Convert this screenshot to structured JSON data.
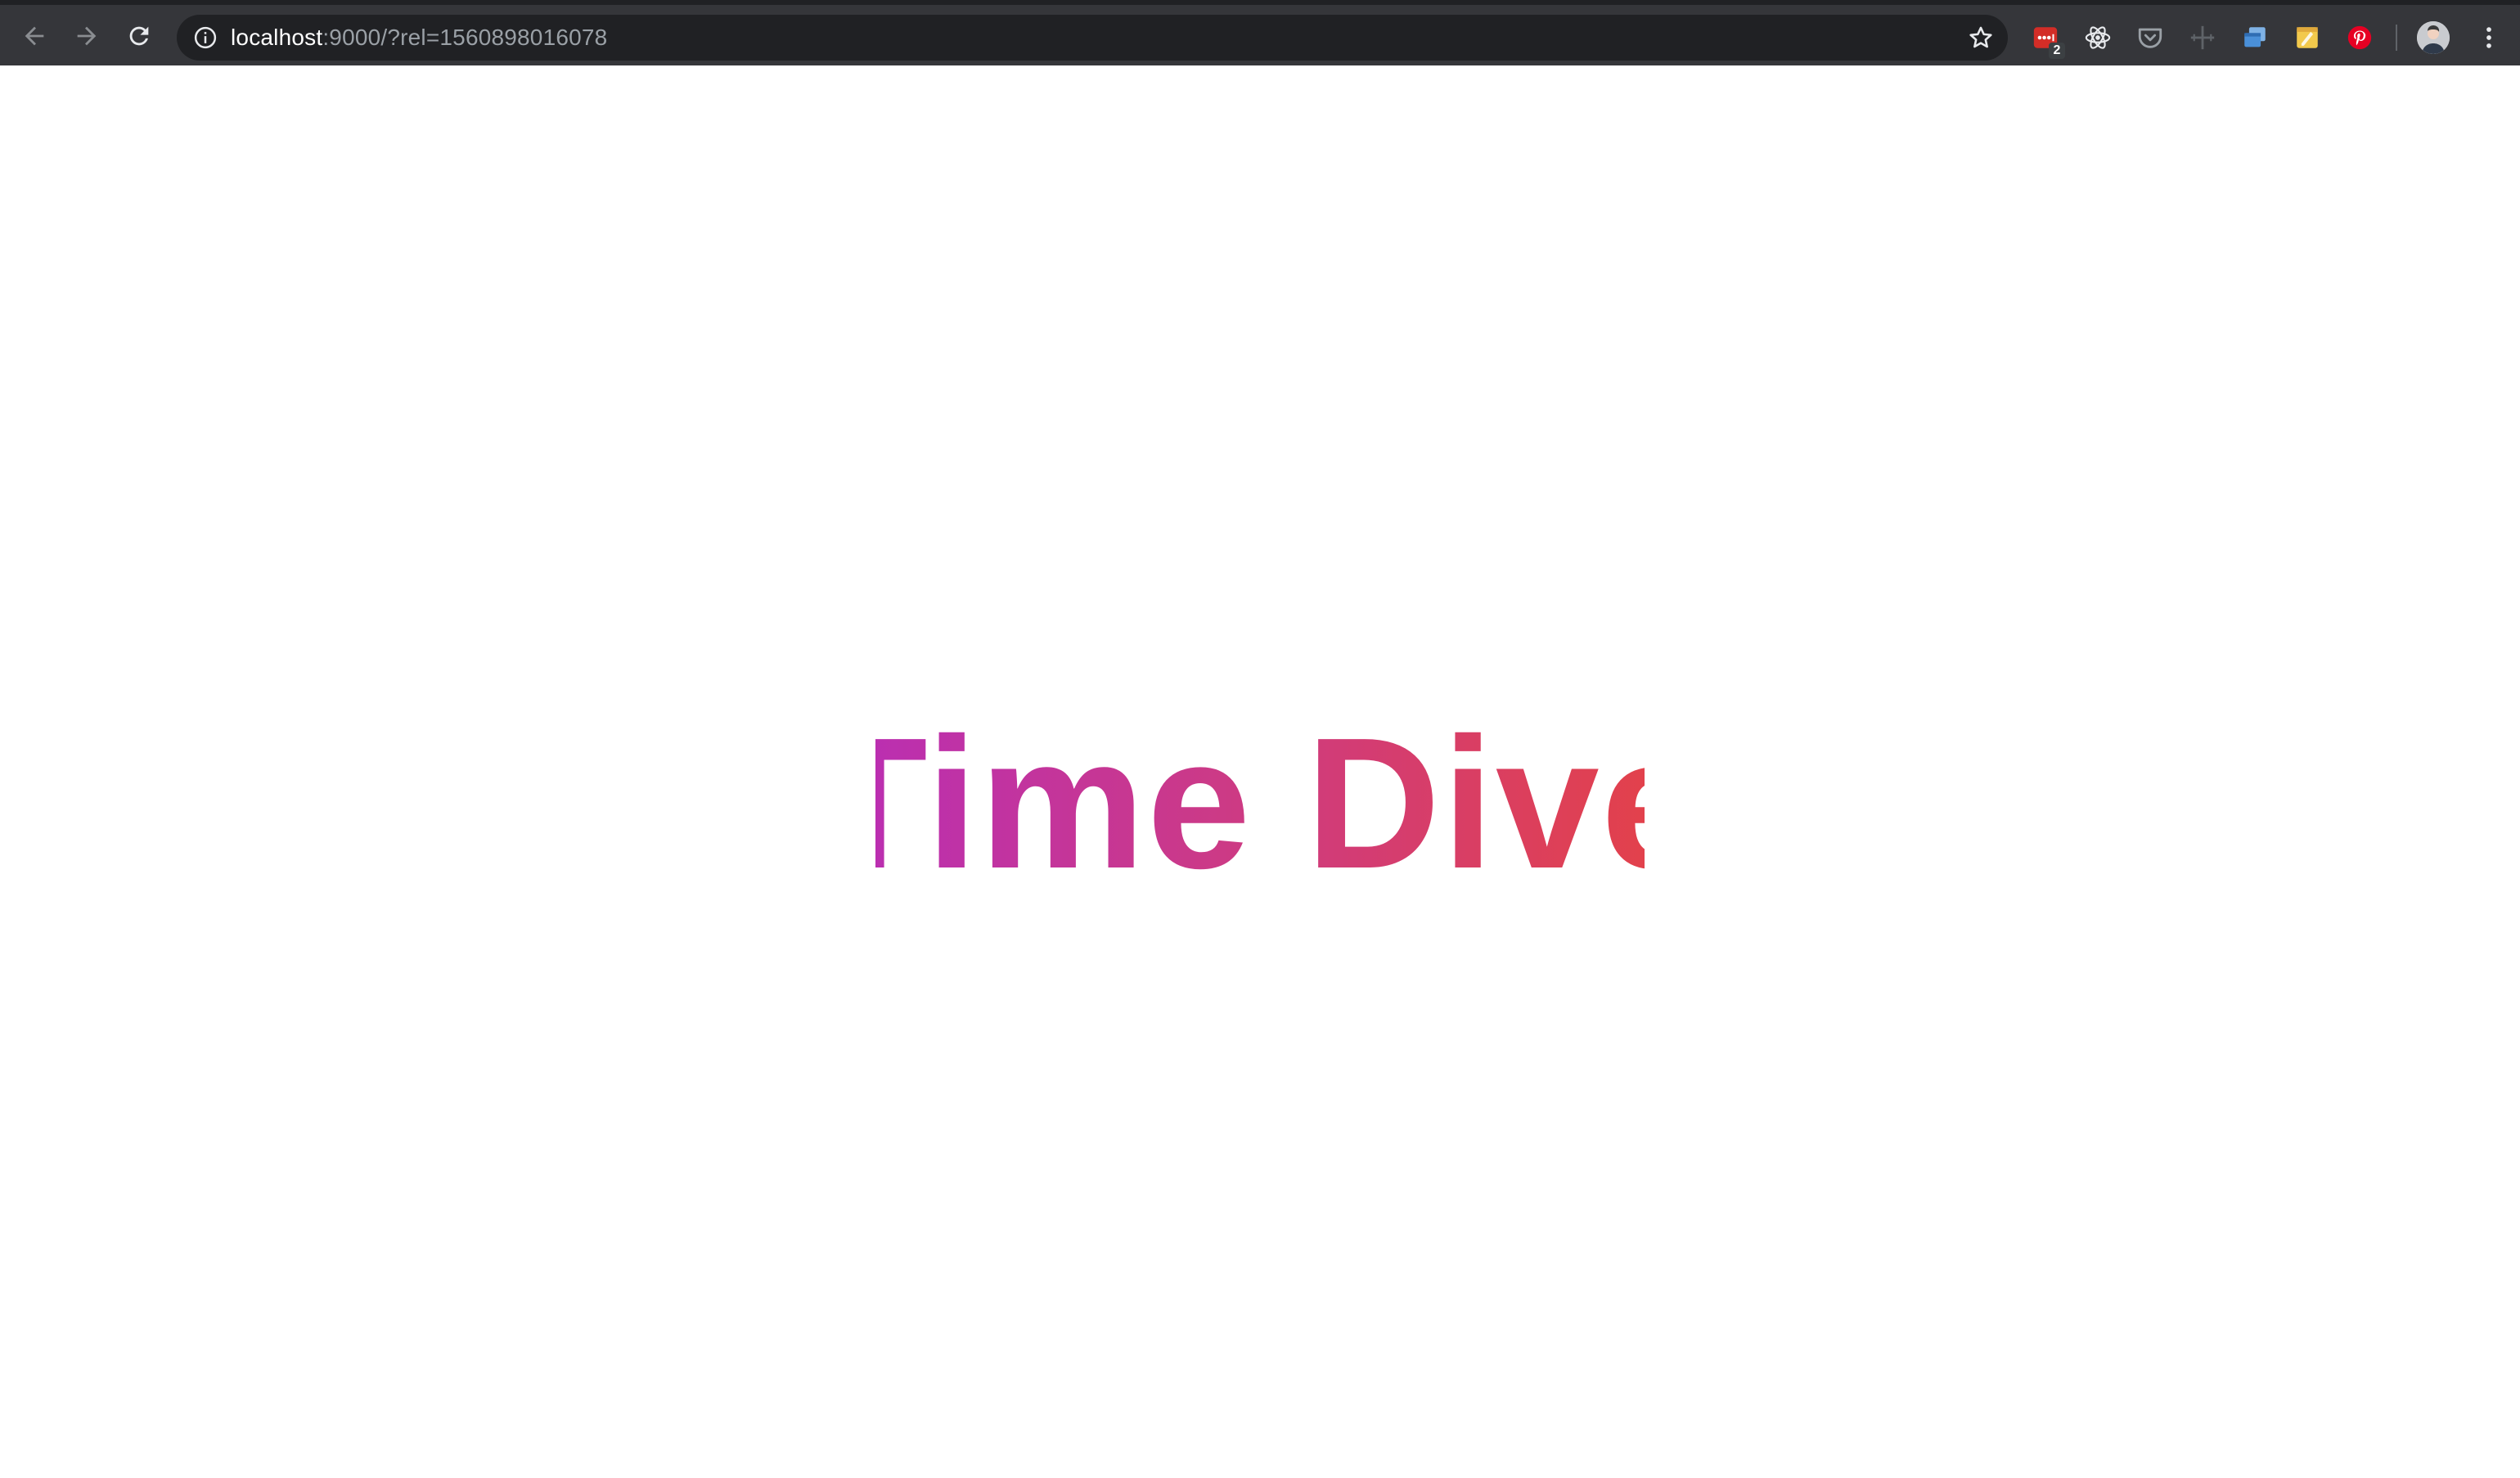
{
  "browser": {
    "url_host": "localhost",
    "url_rest": ":9000/?rel=1560898016078",
    "icons": {
      "back": "back-arrow-icon",
      "forward": "forward-arrow-icon",
      "reload": "reload-icon",
      "info": "info-icon",
      "bookmark": "star-icon",
      "menu": "three-dot-menu-icon"
    },
    "extensions": [
      {
        "name": "lastpass-extension-icon",
        "badge": "2",
        "color": "#d32d27"
      },
      {
        "name": "react-devtools-extension-icon",
        "color": "#e8eaed"
      },
      {
        "name": "pocket-extension-icon",
        "color": "#9aa0a6"
      },
      {
        "name": "ruler-extension-icon",
        "color": "#5f6368"
      },
      {
        "name": "window-resizer-extension-icon",
        "color": "#4a90d9"
      },
      {
        "name": "notes-extension-icon",
        "color": "#f2c94c"
      },
      {
        "name": "pinterest-extension-icon",
        "color": "#e60023"
      }
    ],
    "toolbar_color": "#35363a",
    "omnibox_color": "#202124"
  },
  "page": {
    "title": "Time Dive",
    "gradient_start": "#bb2fb0",
    "gradient_end": "#e2414c"
  }
}
